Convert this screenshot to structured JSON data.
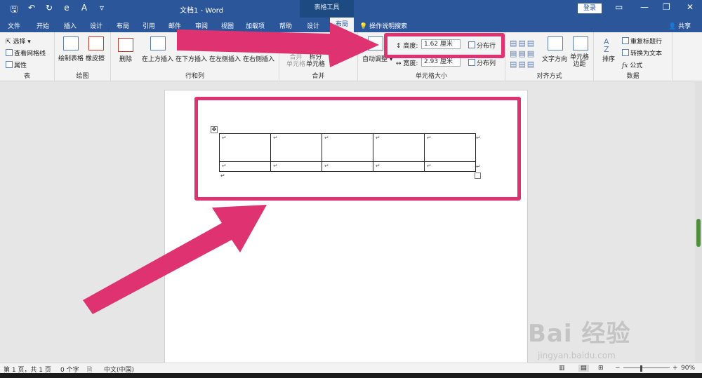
{
  "qat": {
    "save": "🖫",
    "undo": "↶",
    "redo": "↻",
    "formula": "e",
    "font_color": "A",
    "customize": "▿"
  },
  "title": {
    "doc": "文档1  -  Word",
    "tools": "表格工具"
  },
  "account": {
    "login": "登录",
    "share": "共享"
  },
  "tabs": [
    "文件",
    "开始",
    "插入",
    "设计",
    "布局",
    "引用",
    "邮件",
    "审阅",
    "视图",
    "加载项",
    "帮助",
    "设计",
    "布局"
  ],
  "tell_me": "操作说明搜索",
  "ribbon": {
    "table": {
      "select": "选择",
      "gridlines": "查看网格线",
      "properties": "属性",
      "label": "表"
    },
    "draw": {
      "draw_table": "绘制表格",
      "eraser": "橡皮擦",
      "label": "绘图"
    },
    "rows_cols": {
      "delete": "删除",
      "insert_above": "在上方插入",
      "insert_below": "在下方插入",
      "insert_left": "在左侧插入",
      "insert_right": "在右侧插入",
      "label": "行和列"
    },
    "merge": {
      "merge_cells": [
        "合并",
        "单元格"
      ],
      "split_cells": [
        "拆分",
        "单元格"
      ],
      "label": "合并"
    },
    "cell_size": {
      "autofit": "自动调整",
      "height_label": "高度:",
      "height_value": "1.62 厘米",
      "width_label": "宽度:",
      "width_value": "2.93 厘米",
      "distribute_rows": "分布行",
      "distribute_cols": "分布列",
      "label": "单元格大小"
    },
    "alignment": {
      "text_direction": "文字方向",
      "cell_margins": [
        "单元格",
        "边距"
      ],
      "label": "对齐方式"
    },
    "data": {
      "sort": "排序",
      "repeat_header": "重复标题行",
      "convert_text": "转换为文本",
      "formula": "公式",
      "label": "数据"
    }
  },
  "table_cells": {
    "row1": [
      "↵",
      "↵",
      "↵",
      "↵",
      "↵"
    ],
    "row2": [
      "↵",
      "↵",
      "↵",
      "↵",
      "↵"
    ],
    "para_mark": "↵",
    "end_marks": "↵"
  },
  "status": {
    "page": "第 1 页，共 1 页",
    "words": "0 个字",
    "language": "中文(中国)",
    "zoom": "90%"
  },
  "watermark": {
    "main": "Bai 经验",
    "sub": "jingyan.baidu.com"
  },
  "colors": {
    "brand": "#2b579a",
    "highlight": "#de3370"
  }
}
